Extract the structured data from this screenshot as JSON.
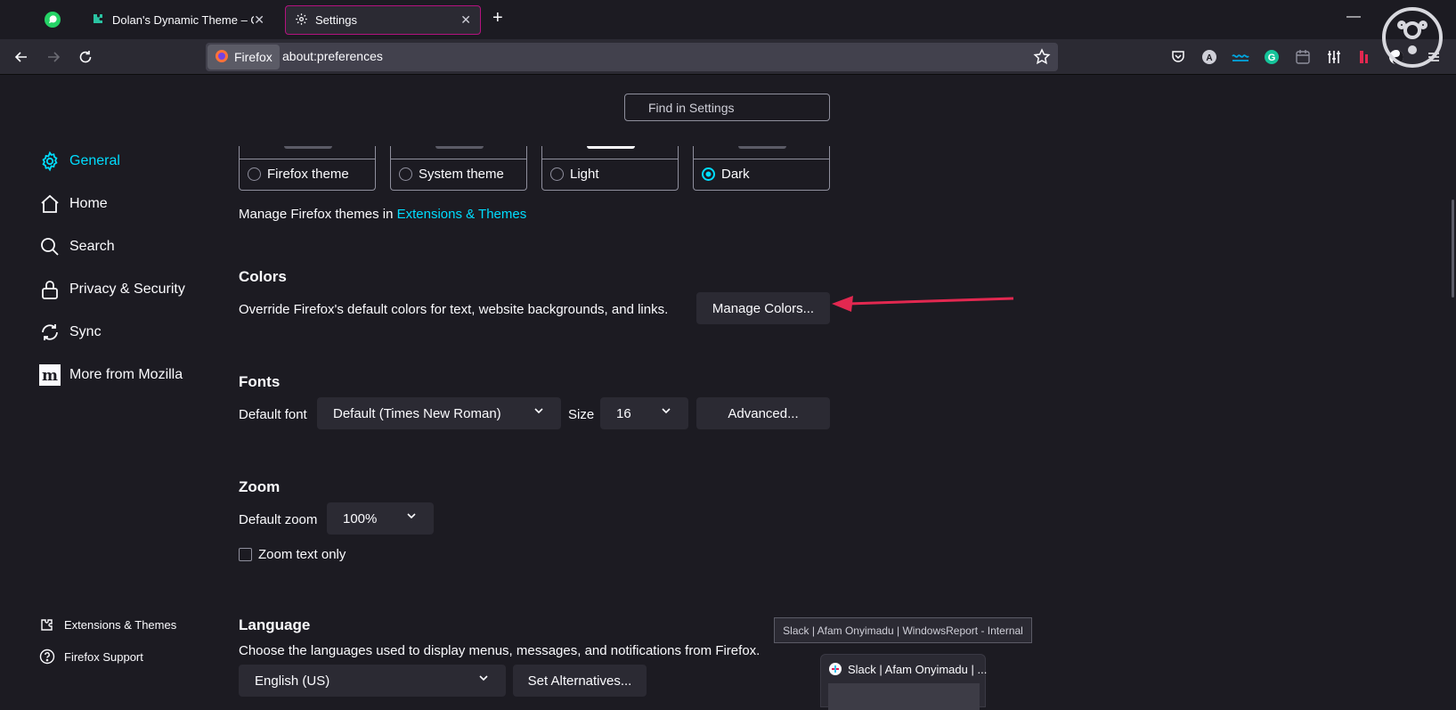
{
  "tabs": [
    {
      "title": "Dolan's Dynamic Theme – Get this",
      "icon": "puzzle-icon"
    },
    {
      "title": "Settings",
      "icon": "gear-icon",
      "active": true
    }
  ],
  "urlbar": {
    "identity": "Firefox",
    "url": "about:preferences"
  },
  "search": {
    "placeholder": "Find in Settings"
  },
  "categories": [
    {
      "label": "General",
      "icon": "gear-icon",
      "selected": true
    },
    {
      "label": "Home",
      "icon": "home-icon"
    },
    {
      "label": "Search",
      "icon": "search-icon"
    },
    {
      "label": "Privacy & Security",
      "icon": "lock-icon"
    },
    {
      "label": "Sync",
      "icon": "sync-icon"
    },
    {
      "label": "More from Mozilla",
      "icon": "mozilla-icon"
    }
  ],
  "footer": {
    "extensions": "Extensions & Themes",
    "support": "Firefox Support"
  },
  "themes": {
    "options": [
      {
        "label": "Firefox theme",
        "selected": false
      },
      {
        "label": "System theme",
        "selected": false
      },
      {
        "label": "Light",
        "selected": false
      },
      {
        "label": "Dark",
        "selected": true
      }
    ],
    "manage_text": "Manage Firefox themes in",
    "manage_link": "Extensions & Themes"
  },
  "colors": {
    "heading": "Colors",
    "description": "Override Firefox's default colors for text, website backgrounds, and links.",
    "button": "Manage Colors..."
  },
  "fonts": {
    "heading": "Fonts",
    "default_font_label": "Default font",
    "default_font_value": "Default (Times New Roman)",
    "size_label": "Size",
    "size_value": "16",
    "advanced_button": "Advanced..."
  },
  "zoom": {
    "heading": "Zoom",
    "default_zoom_label": "Default zoom",
    "default_zoom_value": "100%",
    "text_only_label": "Zoom text only"
  },
  "language": {
    "heading": "Language",
    "description": "Choose the languages used to display menus, messages, and notifications from Firefox.",
    "value": "English (US)",
    "alternatives_button": "Set Alternatives..."
  },
  "taskbar": {
    "tooltip": "Slack | Afam Onyimadu | WindowsReport - Internal",
    "preview_title": "Slack | Afam Onyimadu | ..."
  },
  "colors_palette": {
    "accent": "#00ddff",
    "bg": "#1c1b22",
    "arrow": "#e22850",
    "tab_border": "#b4127f"
  }
}
